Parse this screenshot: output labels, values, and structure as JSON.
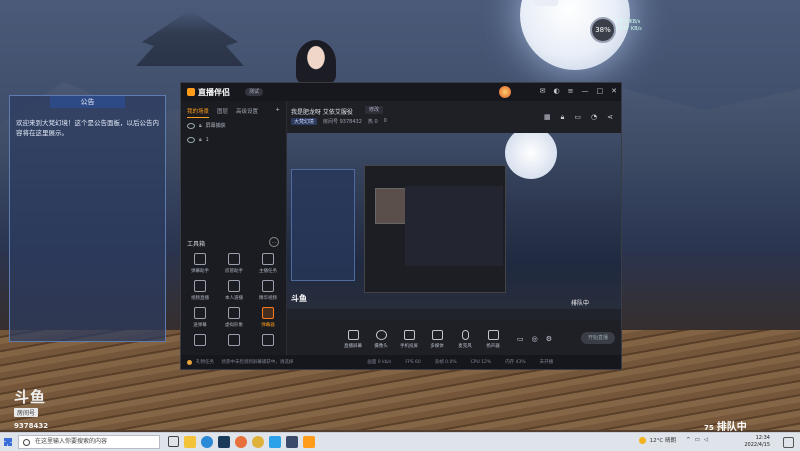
{
  "background": {
    "sky": "#3c4a66",
    "deck": "#7a5a3c"
  },
  "notice": {
    "title": "公告",
    "body": "欢迎来到大梵幻境！这个是公告面板，以后公告内容将在这里展示。"
  },
  "top_right": {
    "percent": "38%",
    "net_up": "↑ 0.2 KB/s",
    "net_down": "↓ 147 KB/s"
  },
  "app": {
    "logo": "直播伴侣",
    "version": "测试",
    "sidebar_tabs": [
      "我的场景",
      "图层",
      "高级设置"
    ],
    "scenes": [
      {
        "label": "屏幕捕获"
      },
      {
        "label": "1"
      }
    ],
    "toolbox_title": "工具箱",
    "tools": [
      {
        "label": "弹幕助手",
        "icon": "danmaku-icon"
      },
      {
        "label": "房管助手",
        "icon": "user-icon"
      },
      {
        "label": "主播任务",
        "icon": "task-icon"
      },
      {
        "label": "视频直播",
        "icon": "video-icon"
      },
      {
        "label": "本人道播",
        "icon": "download-icon"
      },
      {
        "label": "精华视频",
        "icon": "clip-icon"
      },
      {
        "label": "送弹幕",
        "icon": "gift-icon"
      },
      {
        "label": "虚拟形象",
        "icon": "avatar-icon"
      },
      {
        "label": "弹幕器",
        "icon": "controller-icon"
      },
      {
        "label": "",
        "icon": "box-icon"
      },
      {
        "label": "",
        "icon": "live-icon"
      },
      {
        "label": "",
        "icon": "download-icon"
      }
    ],
    "room_title": "我是肥龙呀 艾依艾服役",
    "edit_label": "修改",
    "category": "大梵幻境",
    "room_meta": [
      "房间号 9378432",
      "热 0",
      "0"
    ],
    "controls": [
      {
        "label": "直播屏幕",
        "icon": "screen-icon"
      },
      {
        "label": "摄像头",
        "icon": "camera-icon"
      },
      {
        "label": "手机投屏",
        "icon": "phone-cast-icon"
      },
      {
        "label": "多媒体",
        "icon": "media-icon"
      },
      {
        "label": "麦克风",
        "icon": "mic-icon"
      },
      {
        "label": "扬声器",
        "icon": "speaker-icon"
      }
    ],
    "start_label": "开始直播",
    "status_left": "礼物任务 　 场景中未检测到屏幕捕获中，请选择",
    "status_items": [
      "画面 0 kb/s",
      "FPS 60",
      "丢帧 0.0%",
      "CPU 12%",
      "内存 43%",
      "未开播"
    ],
    "preview": {
      "douyu": "斗鱼",
      "queue_label": "排队中"
    }
  },
  "brand": {
    "name": "斗鱼",
    "room_tag": "房间号",
    "room_number": "9378432"
  },
  "queue": {
    "number": "75",
    "label": "排队中"
  },
  "taskbar": {
    "search_placeholder": "在这里输入你要搜索的内容",
    "temperature": "12°C 晴朗",
    "time": "12:34",
    "date": "2022/4/15"
  }
}
